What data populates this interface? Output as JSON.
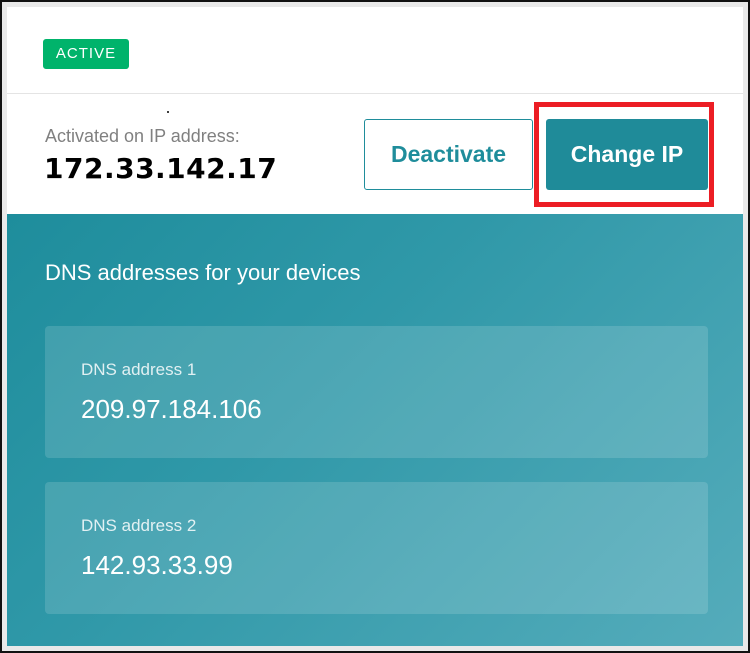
{
  "status": {
    "badge_label": "ACTIVE",
    "colors": {
      "badge_background": "#00b36b",
      "accent": "#1f8b99",
      "highlight": "#ec1d24"
    }
  },
  "activation": {
    "label": "Activated on IP address:",
    "ip_address": "172.33.142.17"
  },
  "actions": {
    "deactivate_label": "Deactivate",
    "change_ip_label": "Change IP"
  },
  "dns_section": {
    "heading": "DNS addresses for your devices",
    "addresses": [
      {
        "label": "DNS address 1",
        "value": "209.97.184.106"
      },
      {
        "label": "DNS address 2",
        "value": "142.93.33.99"
      }
    ]
  }
}
